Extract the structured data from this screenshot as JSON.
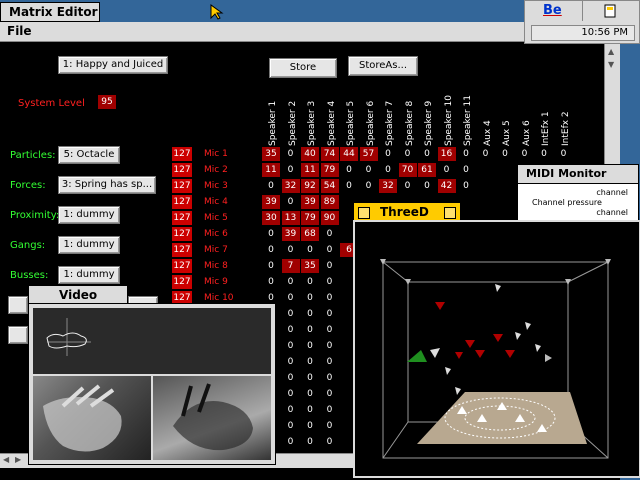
{
  "main_window": {
    "title": "Matrix Editor",
    "menu": {
      "file": "File"
    }
  },
  "top_buttons": {
    "preset": "1: Happy and Juiced",
    "store": "Store",
    "store_as": "StoreAs..."
  },
  "system_level": {
    "label": "System Level",
    "value": "95"
  },
  "controls": [
    {
      "label": "Particles:",
      "value": "5: Octacle"
    },
    {
      "label": "Forces:",
      "value": "3: Spring has sp..."
    },
    {
      "label": "Proximity:",
      "value": "1: dummy"
    },
    {
      "label": "Gangs:",
      "value": "1: dummy"
    },
    {
      "label": "Busses:",
      "value": "1: dummy"
    }
  ],
  "columns": [
    "Speaker 1",
    "Speaker 2",
    "Speaker 3",
    "Speaker 4",
    "Speaker 5",
    "Speaker 6",
    "Speaker 7",
    "Speaker 8",
    "Speaker 9",
    "Speaker 10",
    "Speaker 11",
    "Aux 4",
    "Aux 5",
    "Aux 6",
    "IntEfx 1",
    "IntEfx 2"
  ],
  "rows": [
    {
      "level": "127",
      "name": "Mic 1",
      "cells": [
        "35",
        "0",
        "40",
        "74",
        "44",
        "57",
        "0",
        "0",
        "0",
        "16",
        "0",
        "0",
        "0",
        "0",
        "0",
        "0"
      ]
    },
    {
      "level": "127",
      "name": "Mic 2",
      "cells": [
        "11",
        "0",
        "11",
        "79",
        "0",
        "0",
        "0",
        "70",
        "61",
        "0",
        "0"
      ]
    },
    {
      "level": "127",
      "name": "Mic 3",
      "cells": [
        "0",
        "32",
        "92",
        "54",
        "0",
        "0",
        "32",
        "0",
        "0",
        "42",
        "0"
      ]
    },
    {
      "level": "127",
      "name": "Mic 4",
      "cells": [
        "39",
        "0",
        "39",
        "89"
      ]
    },
    {
      "level": "127",
      "name": "Mic 5",
      "cells": [
        "30",
        "13",
        "79",
        "90"
      ]
    },
    {
      "level": "127",
      "name": "Mic 6",
      "cells": [
        "0",
        "39",
        "68",
        "0"
      ]
    },
    {
      "level": "127",
      "name": "Mic 7",
      "cells": [
        "0",
        "0",
        "0",
        "0",
        "6"
      ]
    },
    {
      "level": "127",
      "name": "Mic 8",
      "cells": [
        "0",
        "7",
        "35",
        "0"
      ]
    },
    {
      "level": "127",
      "name": "Mic 9",
      "cells": [
        "0",
        "0",
        "0",
        "0"
      ]
    },
    {
      "level": "127",
      "name": "Mic 10",
      "cells": [
        "0",
        "0",
        "0",
        "0"
      ]
    },
    {
      "level": "",
      "name": "",
      "cells": [
        "0",
        "0",
        "0",
        "0"
      ]
    },
    {
      "level": "",
      "name": "",
      "cells": [
        "0",
        "0",
        "0",
        "0"
      ]
    },
    {
      "level": "",
      "name": "",
      "cells": [
        "0",
        "0",
        "0",
        "0"
      ]
    },
    {
      "level": "",
      "name": "",
      "cells": [
        "0",
        "0",
        "0",
        "0"
      ]
    },
    {
      "level": "",
      "name": "",
      "cells": [
        "0",
        "0",
        "0",
        "0"
      ]
    },
    {
      "level": "",
      "name": "",
      "cells": [
        "0",
        "0",
        "0",
        "0"
      ]
    },
    {
      "level": "",
      "name": "",
      "cells": [
        "0",
        "0",
        "0",
        "0"
      ]
    },
    {
      "level": "",
      "name": "",
      "cells": [
        "0",
        "0",
        "0",
        "0"
      ]
    },
    {
      "level": "",
      "name": "",
      "cells": [
        "0",
        "0",
        "0",
        "0"
      ]
    }
  ],
  "video_window": {
    "title": "Video"
  },
  "threed_window": {
    "title": "ThreeD"
  },
  "midi_window": {
    "title": "MIDI Monitor",
    "lines": [
      "channel",
      "Channel pressure",
      "channel"
    ]
  },
  "deskbar": {
    "logo": "Be",
    "clock": "10:56 PM"
  },
  "colors": {
    "title_active": "#ffcb00",
    "title_inactive": "#dcdcdc",
    "level_red": "#cc0000",
    "label_green": "#33ff33",
    "desktop": "#336699"
  }
}
